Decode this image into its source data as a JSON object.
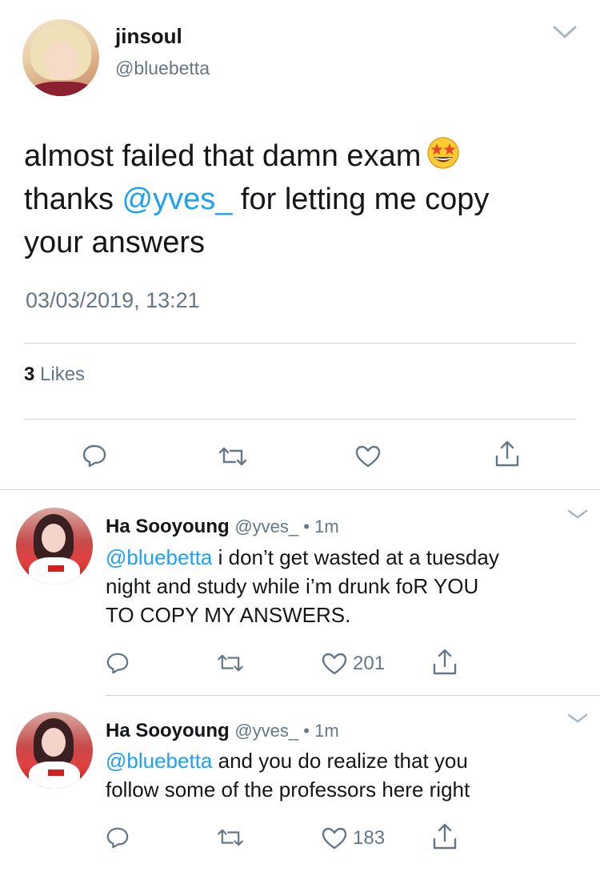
{
  "main_tweet": {
    "display_name": "jinsoul",
    "handle": "@bluebetta",
    "text_line1": "almost failed that damn exam",
    "emoji": "star-struck-emoji",
    "text_line2_prefix": "thanks ",
    "text_line2_mention": "@yves_",
    "text_line2_suffix": " for letting me copy",
    "text_line3": "your answers",
    "timestamp": "03/03/2019, 13:21",
    "likes_count": "3",
    "likes_label": " Likes"
  },
  "replies": [
    {
      "display_name": "Ha Sooyoung",
      "handle": "@yves_",
      "separator": " • ",
      "time": "1m",
      "mention": "@bluebetta",
      "text_line1": " i don’t get wasted at a tuesday",
      "text_line2": "night and study while i’m drunk foR YOU",
      "text_line3": "TO COPY MY ANSWERS.",
      "like_count": "201"
    },
    {
      "display_name": "Ha Sooyoung",
      "handle": "@yves_",
      "separator": " • ",
      "time": "1m",
      "mention": "@bluebetta",
      "text_line1": " and you do realize that you",
      "text_line2": "follow some of the professors here right",
      "like_count": "183"
    }
  ],
  "icons": [
    "reply-icon",
    "retweet-icon",
    "like-icon",
    "share-icon",
    "chevron-down-icon"
  ],
  "colors": {
    "mention": "#1da1f2",
    "secondary_text": "#657786",
    "divider": "#ccd6dd"
  }
}
